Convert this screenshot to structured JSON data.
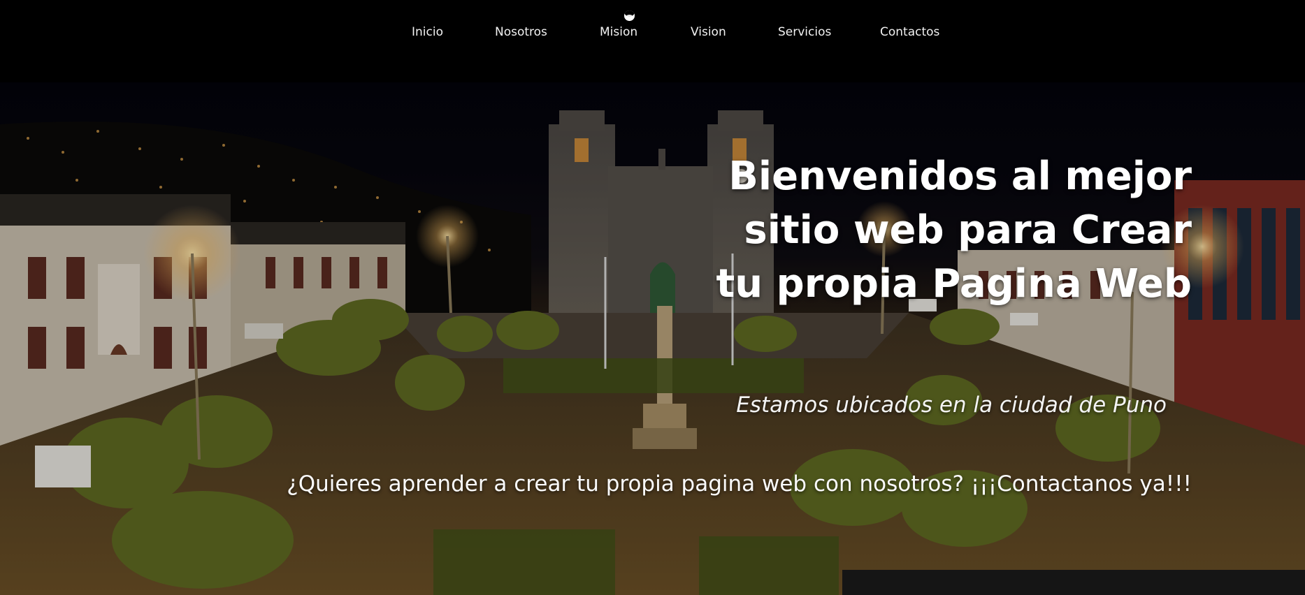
{
  "nav": {
    "items": [
      {
        "label": "Inicio"
      },
      {
        "label": "Nosotros"
      },
      {
        "label": "Mision"
      },
      {
        "label": "Vision"
      },
      {
        "label": "Servicios"
      },
      {
        "label": "Contactos"
      }
    ]
  },
  "hero": {
    "title": "Bienvenidos al mejor sitio web para Crear tu propia Pagina Web",
    "location": "Estamos ubicados en la ciudad de Puno",
    "cta": "¿Quieres aprender a crear tu propia pagina web con nosotros? ¡¡¡Contactanos ya!!!"
  },
  "colors": {
    "nav_background": "#000000",
    "text": "#ffffff",
    "night_sky": "#05050d",
    "street_light": "#f0c060"
  },
  "icons": {
    "moon": "moon-icon"
  }
}
